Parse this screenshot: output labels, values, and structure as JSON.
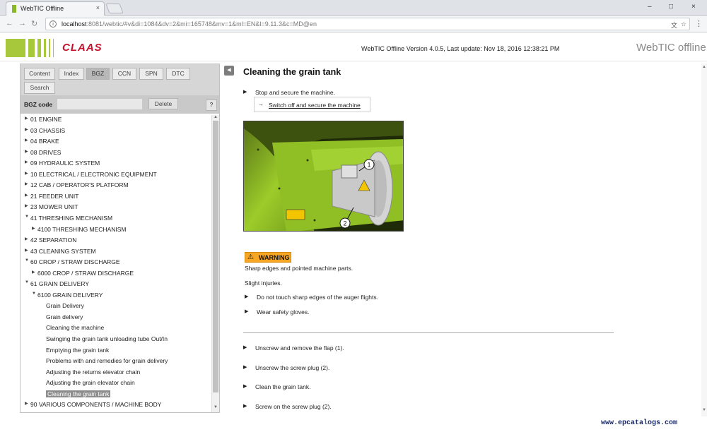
{
  "browser": {
    "tab_title": "WebTIC Offline",
    "tab_close": "×",
    "url_host": "localhost",
    "url_rest": ":8081/webtic/#v&di=1084&dv=2&mi=165748&mv=1&ml=EN&l=9.11.3&c=MD@en",
    "win_min": "–",
    "win_max": "□",
    "win_close": "×"
  },
  "header": {
    "brand": "CLAAS",
    "version_info": "WebTIC Offline Version 4.0.5, Last update: Nov 18, 2016 12:38:21 PM",
    "product": "WebTIC offline"
  },
  "left": {
    "tabs": [
      {
        "label": "Content"
      },
      {
        "label": "Index"
      },
      {
        "label": "BGZ"
      },
      {
        "label": "CCN"
      },
      {
        "label": "SPN"
      },
      {
        "label": "DTC"
      },
      {
        "label": "Search"
      }
    ],
    "active_tab": "BGZ",
    "code_label": "BGZ code",
    "code_value": "",
    "delete_label": "Delete",
    "help_label": "?",
    "tree": [
      {
        "label": "01 ENGINE",
        "level": 0,
        "expanded": false
      },
      {
        "label": "03 CHASSIS",
        "level": 0,
        "expanded": false
      },
      {
        "label": "04 BRAKE",
        "level": 0,
        "expanded": false
      },
      {
        "label": "08 DRIVES",
        "level": 0,
        "expanded": false
      },
      {
        "label": "09 HYDRAULIC SYSTEM",
        "level": 0,
        "expanded": false
      },
      {
        "label": "10 ELECTRICAL / ELECTRONIC EQUIPMENT",
        "level": 0,
        "expanded": false
      },
      {
        "label": "12 CAB / OPERATOR'S PLATFORM",
        "level": 0,
        "expanded": false
      },
      {
        "label": "21 FEEDER UNIT",
        "level": 0,
        "expanded": false
      },
      {
        "label": "23 MOWER UNIT",
        "level": 0,
        "expanded": false
      },
      {
        "label": "41 THRESHING MECHANISM",
        "level": 0,
        "expanded": true
      },
      {
        "label": "4100 THRESHING MECHANISM",
        "level": 1,
        "expanded": false
      },
      {
        "label": "42 SEPARATION",
        "level": 0,
        "expanded": false
      },
      {
        "label": "43 CLEANING SYSTEM",
        "level": 0,
        "expanded": false
      },
      {
        "label": "60 CROP / STRAW DISCHARGE",
        "level": 0,
        "expanded": true
      },
      {
        "label": "6000 CROP / STRAW DISCHARGE",
        "level": 1,
        "expanded": false
      },
      {
        "label": "61 GRAIN DELIVERY",
        "level": 0,
        "expanded": true
      },
      {
        "label": "6100 GRAIN DELIVERY",
        "level": 1,
        "expanded": true
      },
      {
        "label": "Grain Delivery",
        "level": 2
      },
      {
        "label": "Grain delivery",
        "level": 2
      },
      {
        "label": "Cleaning the machine",
        "level": 2
      },
      {
        "label": "Swinging the grain tank unloading tube Out/In",
        "level": 2
      },
      {
        "label": "Emptying the grain tank",
        "level": 2
      },
      {
        "label": "Problems with and remedies for grain delivery",
        "level": 2
      },
      {
        "label": "Adjusting the returns elevator chain",
        "level": 2
      },
      {
        "label": "Adjusting the grain elevator chain",
        "level": 2
      },
      {
        "label": "Cleaning the grain tank",
        "level": 2,
        "selected": true
      },
      {
        "label": "90 VARIOUS COMPONENTS / MACHINE BODY",
        "level": 0,
        "expanded": false
      }
    ]
  },
  "content": {
    "title": "Cleaning the grain tank",
    "step1": "Stop and secure the machine.",
    "link_label": "Switch off and secure the machine",
    "callout1": "1",
    "callout2": "2",
    "warning_label": "WARNING",
    "hazard": "Sharp edges and pointed machine parts.",
    "consequence": "Slight injuries.",
    "precautions": [
      "Do not touch sharp edges of the auger flights.",
      "Wear safety gloves."
    ],
    "steps": [
      "Unscrew and remove the flap (1).",
      "Unscrew the screw plug (2).",
      "Clean the grain tank.",
      "Screw on the screw plug (2)."
    ]
  },
  "watermark": "www.epcatalogs.com",
  "colors": {
    "brand_red": "#c8102e",
    "brand_green": "#a6c83a",
    "warning_orange": "#f6a623",
    "machine_green": "#9ccc2a"
  },
  "icons": [
    "back-icon",
    "forward-icon",
    "reload-icon",
    "info-icon",
    "translate-icon",
    "star-icon",
    "menu-icon",
    "collapse-icon",
    "warning-icon",
    "arrow-icon"
  ]
}
